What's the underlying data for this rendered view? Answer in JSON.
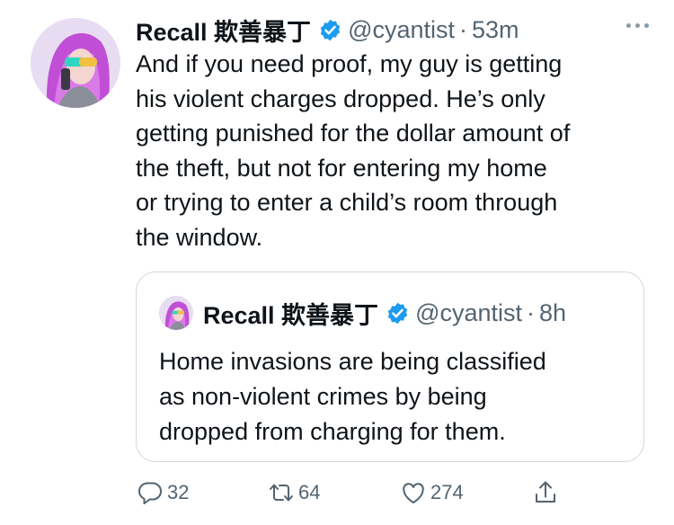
{
  "tweet": {
    "display_name": "Recall 欺善暴丁",
    "handle": "@cyantist",
    "separator": "·",
    "time": "53m",
    "text_lines": [
      "And if you need proof, my guy is getting",
      "his violent charges dropped. He’s only",
      "getting punished for the dollar amount of",
      "the theft, but not for entering my home",
      "or trying to enter a child’s room through",
      "the window."
    ]
  },
  "quote": {
    "display_name": "Recall 欺善暴丁",
    "handle": "@cyantist",
    "separator": "·",
    "time": "8h",
    "text_lines": [
      "Home invasions are being classified",
      "as non-violent crimes by being",
      "dropped from charging for them."
    ]
  },
  "actions": {
    "reply": {
      "icon": "reply-icon",
      "count": "32"
    },
    "retweet": {
      "icon": "retweet-icon",
      "count": "64"
    },
    "like": {
      "icon": "heart-icon",
      "count": "274"
    },
    "share": {
      "icon": "share-icon"
    }
  },
  "icons": {
    "verified": "verified-badge-icon",
    "more": "more-options-icon"
  },
  "colors": {
    "text": "#0f1419",
    "secondary": "#536471",
    "verified": "#1d9bf0",
    "border": "#cfd9de"
  }
}
